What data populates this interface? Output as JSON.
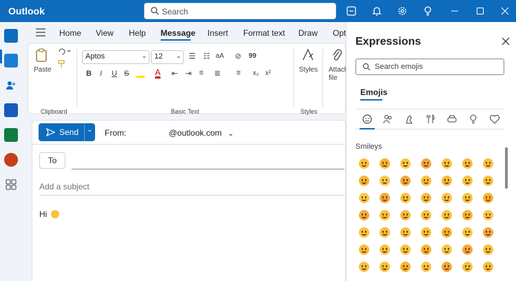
{
  "app": {
    "title": "Outlook"
  },
  "search": {
    "placeholder": "Search"
  },
  "menu_tabs": [
    {
      "label": "Home"
    },
    {
      "label": "View"
    },
    {
      "label": "Help"
    },
    {
      "label": "Message"
    },
    {
      "label": "Insert"
    },
    {
      "label": "Format text"
    },
    {
      "label": "Draw"
    },
    {
      "label": "Opt"
    }
  ],
  "ribbon": {
    "paste_label": "Paste",
    "clipboard_label": "Clipboard",
    "font_name": "Aptos",
    "font_size": "12",
    "basic_text_label": "Basic Text",
    "styles_label": "Styles",
    "styles_group_label": "Styles",
    "attach_label_1": "Attach",
    "attach_label_2": "file",
    "fmt_bold": "B",
    "fmt_italic": "I",
    "fmt_underline": "U",
    "fmt_strike": "S",
    "fmt_sub": "x₂",
    "fmt_sup": "x²",
    "fmt_size": "aA",
    "fmt_quote": "99"
  },
  "compose": {
    "send_label": "Send",
    "from_label": "From:",
    "from_email": "@outlook.com",
    "to_label": "To",
    "subject_placeholder": "Add a subject",
    "body_text": "Hi"
  },
  "expressions": {
    "title": "Expressions",
    "search_placeholder": "Search emojis",
    "tab_label": "Emojis",
    "categories": [
      "smileys-icon",
      "people-icon",
      "animals-icon",
      "food-icon",
      "travel-icon",
      "objects-icon",
      "symbols-icon"
    ],
    "section_label": "Smileys"
  },
  "colors": {
    "accent": "#0f6cbd",
    "emoji": "#f7c33b"
  }
}
